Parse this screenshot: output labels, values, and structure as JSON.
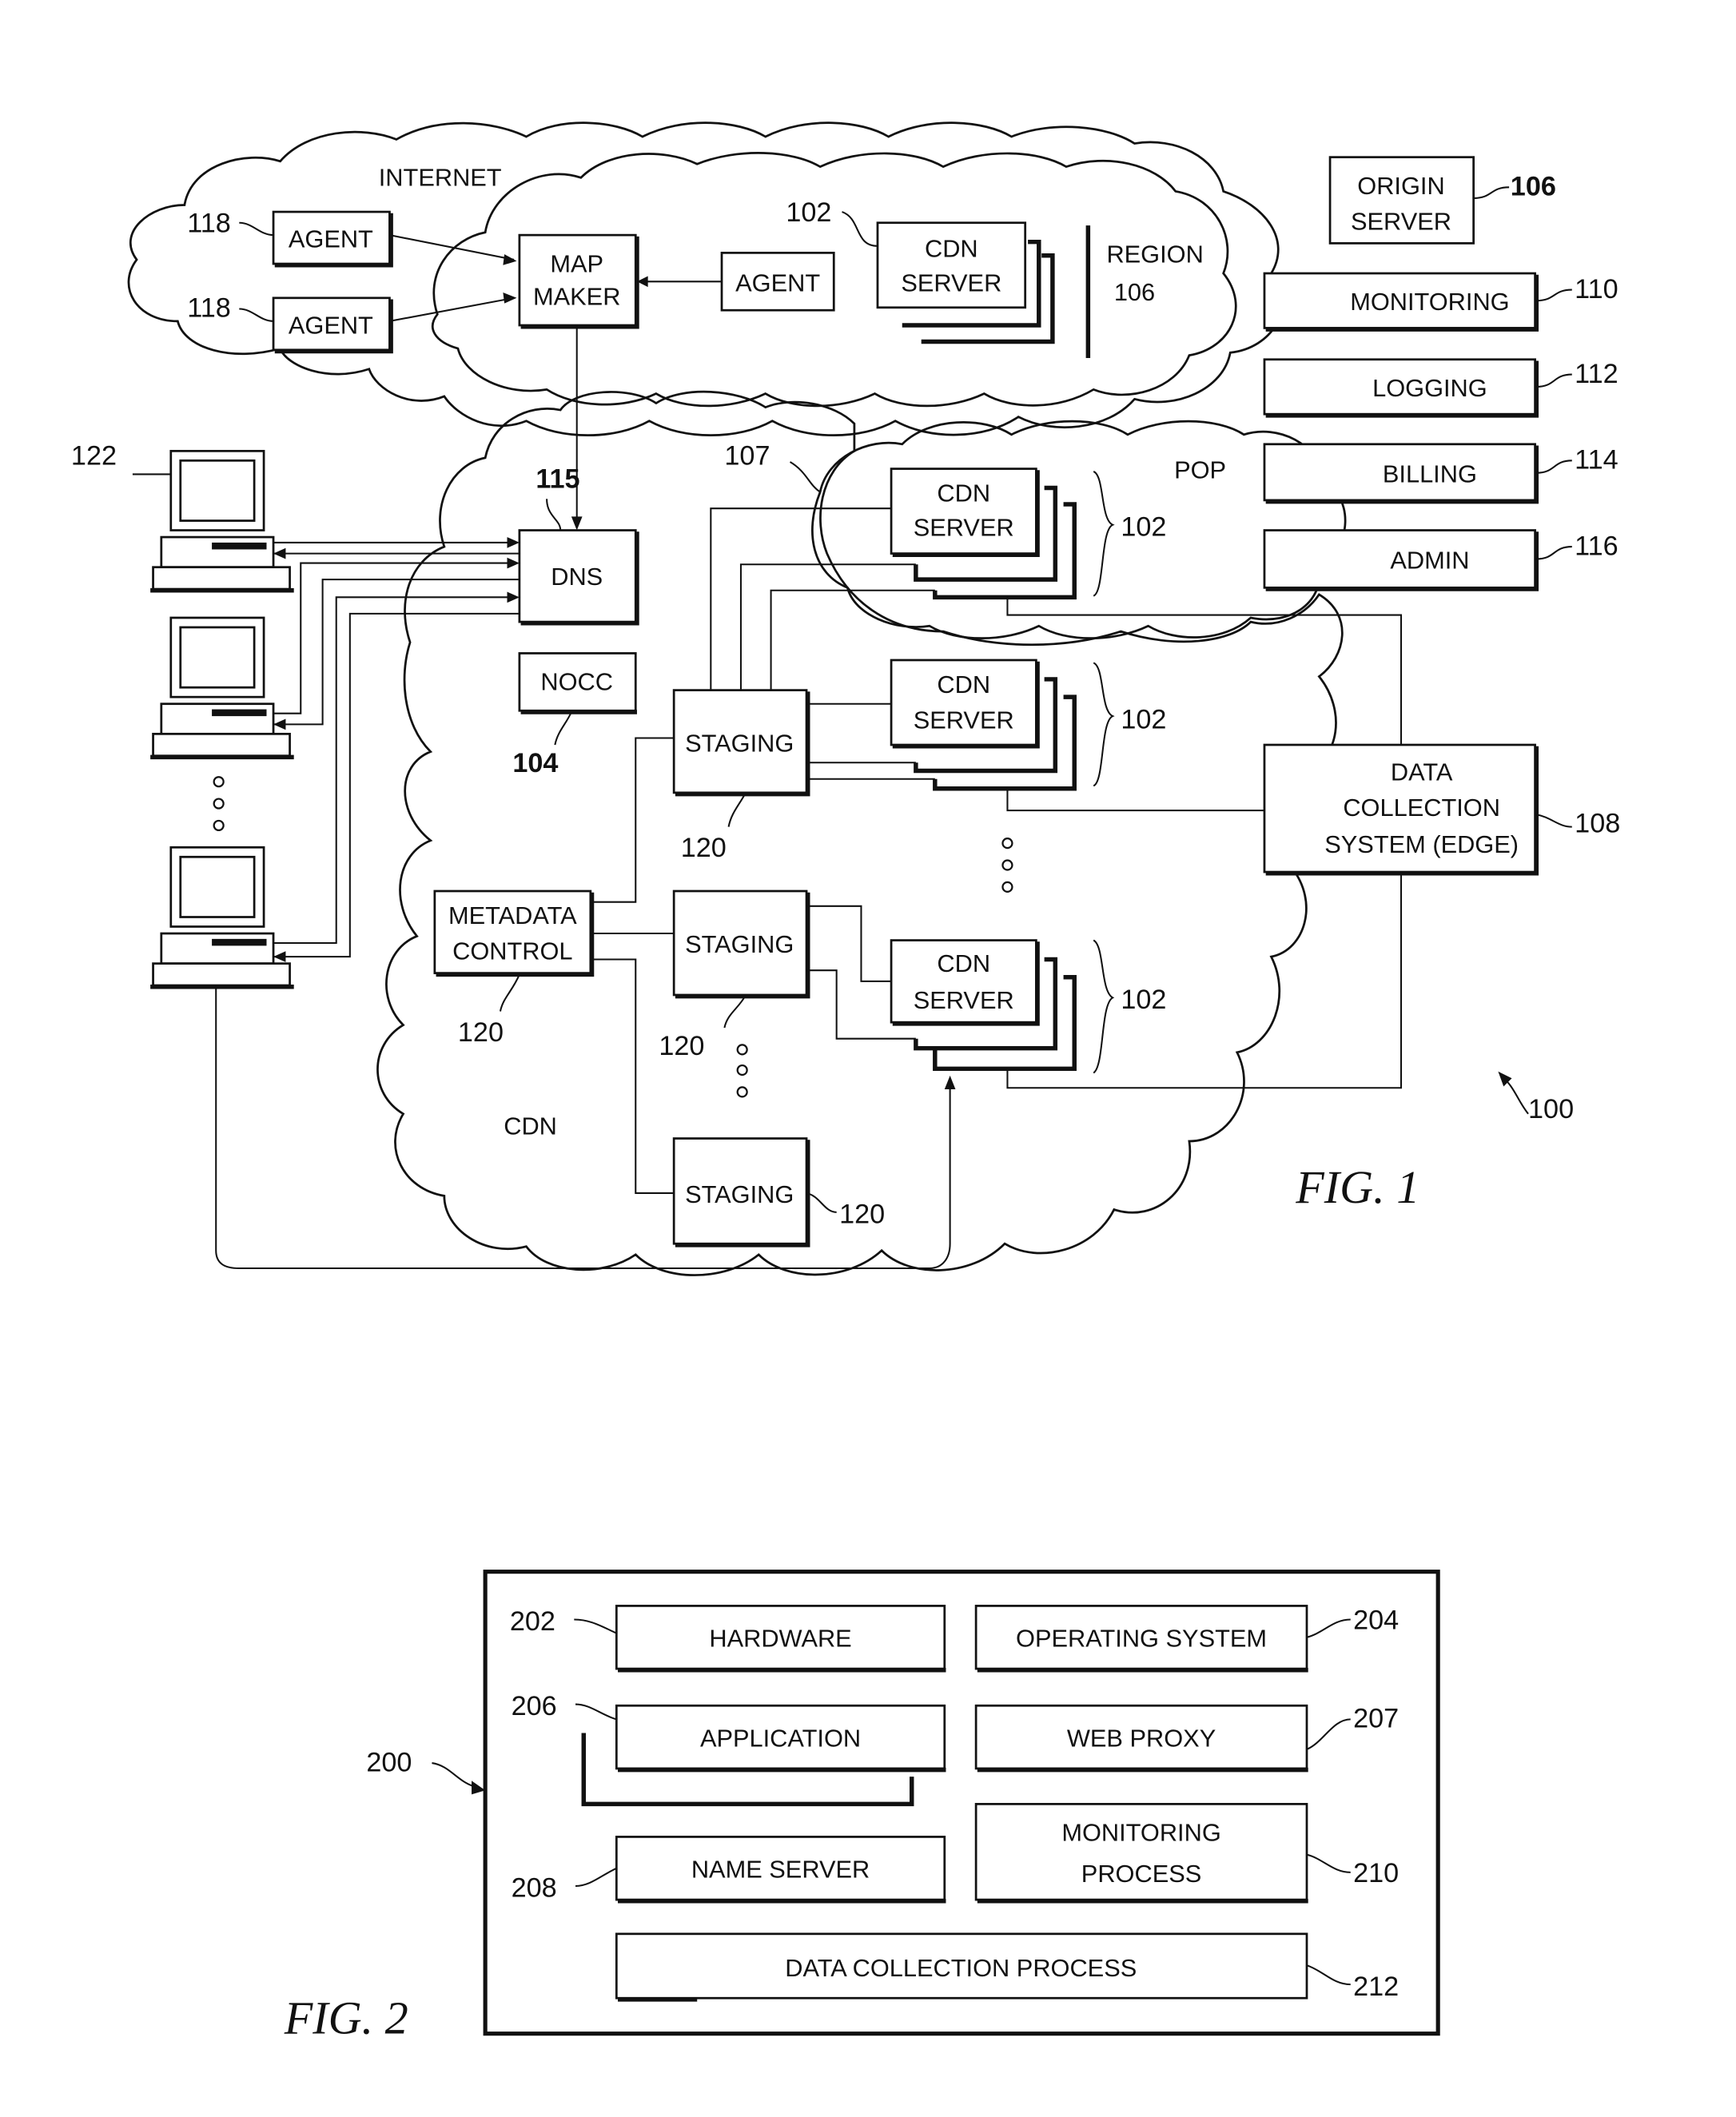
{
  "fig1": {
    "caption": "FIG. 1",
    "system_ref": "100",
    "clouds": {
      "internet": "INTERNET",
      "region": "REGION",
      "region_ref": "106",
      "pop": "POP",
      "pop_ref": "107",
      "cdn": "CDN"
    },
    "agents": [
      {
        "label": "AGENT",
        "ref": "118"
      },
      {
        "label": "AGENT",
        "ref": "118"
      },
      {
        "label": "AGENT"
      }
    ],
    "map_maker": {
      "line1": "MAP",
      "line2": "MAKER"
    },
    "dns": {
      "label": "DNS",
      "ref": "115"
    },
    "nocc": {
      "label": "NOCC",
      "ref": "104"
    },
    "metadata_control": {
      "line1": "METADATA",
      "line2": "CONTROL",
      "ref": "120"
    },
    "staging": [
      {
        "label": "STAGING",
        "ref": "120"
      },
      {
        "label": "STAGING",
        "ref": "120"
      },
      {
        "label": "STAGING",
        "ref": "120"
      }
    ],
    "cdn_servers": [
      {
        "line1": "CDN",
        "line2": "SERVER",
        "ref": "102"
      },
      {
        "line1": "CDN",
        "line2": "SERVER",
        "ref": "102"
      },
      {
        "line1": "CDN",
        "line2": "SERVER",
        "ref": "102"
      },
      {
        "line1": "CDN",
        "line2": "SERVER",
        "ref": "102"
      }
    ],
    "clients_ref": "122",
    "origin_server": {
      "line1": "ORIGIN",
      "line2": "SERVER",
      "ref": "106"
    },
    "side_systems": [
      {
        "label": "MONITORING",
        "ref": "110"
      },
      {
        "label": "LOGGING",
        "ref": "112"
      },
      {
        "label": "BILLING",
        "ref": "114"
      },
      {
        "label": "ADMIN",
        "ref": "116"
      }
    ],
    "data_collection": {
      "line1": "DATA",
      "line2": "COLLECTION",
      "line3": "SYSTEM (EDGE)",
      "ref": "108"
    }
  },
  "fig2": {
    "caption": "FIG. 2",
    "machine_ref": "200",
    "components": [
      {
        "label": "HARDWARE",
        "ref": "202"
      },
      {
        "label": "OPERATING SYSTEM",
        "ref": "204"
      },
      {
        "label": "APPLICATION",
        "ref": "206"
      },
      {
        "label": "WEB PROXY",
        "ref": "207"
      },
      {
        "label": "NAME SERVER",
        "ref": "208"
      },
      {
        "line1": "MONITORING",
        "line2": "PROCESS",
        "ref": "210"
      },
      {
        "label": "DATA COLLECTION PROCESS",
        "ref": "212"
      }
    ]
  }
}
